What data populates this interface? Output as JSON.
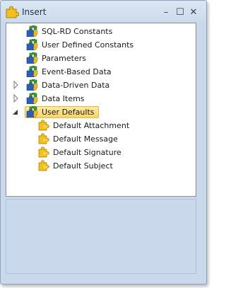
{
  "window": {
    "title": "Insert",
    "icon": "puzzle-icon",
    "controls": {
      "minimize_glyph": "–",
      "maximize_glyph": "☐",
      "close_glyph": "✕"
    }
  },
  "tree": {
    "nodes": [
      {
        "label": "SQL-RD Constants",
        "icon": "puzzle-icon",
        "expander": ""
      },
      {
        "label": "User Defined Constants",
        "icon": "puzzle-icon",
        "expander": ""
      },
      {
        "label": "Parameters",
        "icon": "puzzle-icon",
        "expander": ""
      },
      {
        "label": "Event-Based Data",
        "icon": "puzzle-icon",
        "expander": ""
      },
      {
        "label": "Data-Driven Data",
        "icon": "puzzle-icon",
        "expander": "collapsed"
      },
      {
        "label": "Data Items",
        "icon": "puzzle-icon",
        "expander": "collapsed"
      },
      {
        "label": "User Defaults",
        "icon": "puzzle-icon",
        "expander": "expanded",
        "selected": true,
        "children": [
          {
            "label": "Default Attachment",
            "icon": "puzzle-piece-icon"
          },
          {
            "label": "Default Message",
            "icon": "puzzle-piece-icon"
          },
          {
            "label": "Default Signature",
            "icon": "puzzle-piece-icon"
          },
          {
            "label": "Default Subject",
            "icon": "puzzle-piece-icon"
          }
        ]
      }
    ]
  },
  "colors": {
    "window_bg": "#c9d8ea",
    "selection_bg": "#f8d46a",
    "icon_green": "#3b9a2e",
    "icon_blue": "#2a5fb8",
    "icon_yellow": "#f2c21b"
  }
}
